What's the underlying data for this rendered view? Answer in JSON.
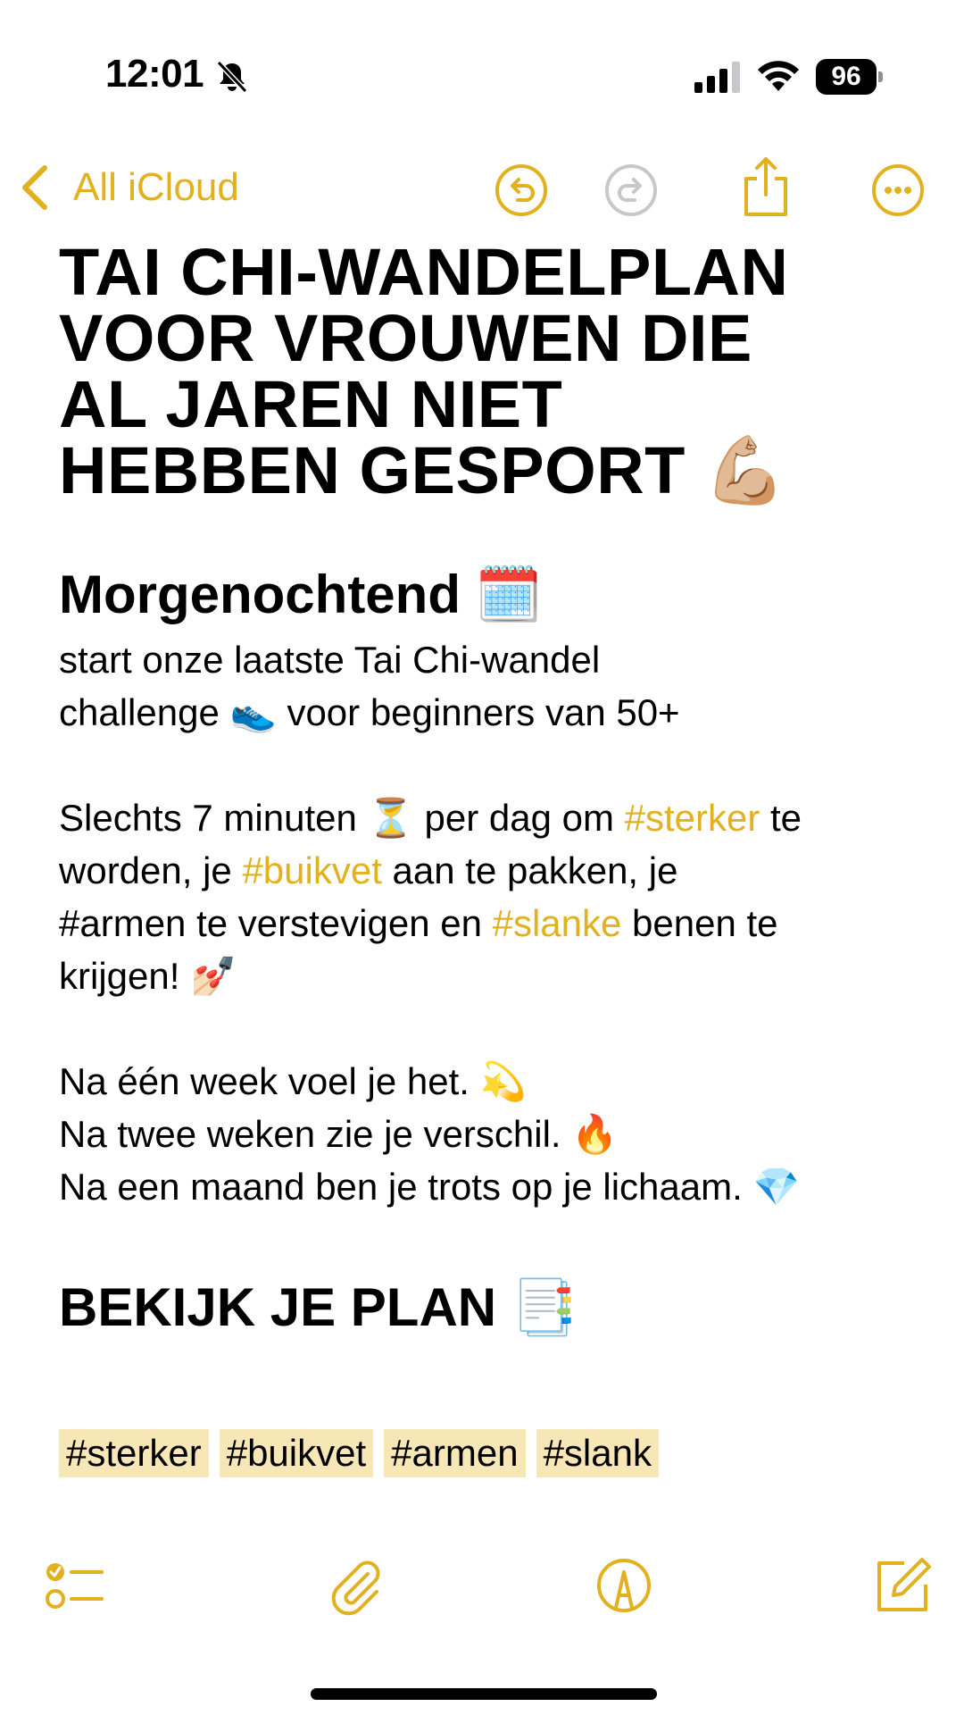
{
  "status_bar": {
    "time": "12:01",
    "battery": "96"
  },
  "nav": {
    "back_label": "All iCloud"
  },
  "note": {
    "title_lines": [
      "TAI CHI-WANDELPLAN",
      "VOOR VROUWEN DIE",
      "AL JAREN NIET",
      "HEBBEN GESPORT 💪🏼"
    ],
    "heading1": "Morgenochtend 🗓️",
    "para1_line1": "start onze laatste Tai Chi-wandel",
    "para1_line2": "challenge 👟 voor beginners van 50+",
    "para2": {
      "a": "Slechts 7 minuten ⏳ per dag om ",
      "tag1": "#sterker",
      "b": " te",
      "c": "worden, je ",
      "tag2": "#buikvet",
      "d": " aan te pakken, je",
      "e": "#armen te verstevigen en ",
      "tag3": "#slanke",
      "f": " benen te",
      "g": "krijgen! 💅🏻"
    },
    "para3": [
      "Na één week voel je het. 💫",
      "Na twee weken zie je verschil. 🔥",
      "Na een maand ben je trots op je lichaam. 💎"
    ],
    "heading2": "BEKIJK JE PLAN 📑",
    "tags": [
      "#sterker",
      "#buikvet",
      "#armen",
      "#slank"
    ]
  },
  "colors": {
    "accent": "#e2b120",
    "tag_highlight": "#f7e6b6"
  },
  "icons": [
    "bell-slash-icon",
    "signal-icon",
    "wifi-icon",
    "battery-icon",
    "chevron-left-icon",
    "undo-icon",
    "redo-icon",
    "share-icon",
    "more-icon",
    "checklist-icon",
    "attachment-icon",
    "markup-icon",
    "compose-icon"
  ]
}
